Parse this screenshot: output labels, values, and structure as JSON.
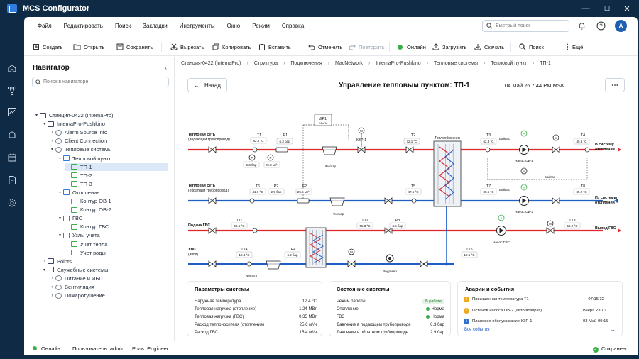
{
  "window": {
    "title": "MCS Configurator",
    "controls": [
      "—",
      "☐",
      "✕"
    ]
  },
  "menu": [
    "Файл",
    "Редактировать",
    "Поиск",
    "Закладки",
    "Инструменты",
    "Окно",
    "Режим",
    "Справка"
  ],
  "quick_search": {
    "placeholder": "Быстрый поиск"
  },
  "user": {
    "avatar": "A"
  },
  "toolbar": {
    "create": "Создать",
    "open": "Открыть",
    "save": "Сохранить",
    "cut": "Вырезать",
    "copy": "Копировать",
    "paste": "Вставить",
    "undo": "Отменить",
    "redo": "Повторить",
    "online": "Онлайн",
    "upload": "Загрузить",
    "download": "Скачать",
    "search": "Поиск",
    "more": "Ещё"
  },
  "navigator": {
    "title": "Навигатор",
    "search_placeholder": "Поиск в навигаторе",
    "tree": [
      {
        "label": "Станция-0422 (IntemaPro)",
        "level": 0,
        "caret": "▾"
      },
      {
        "label": "IntemaPro-Pushkino",
        "level": 1,
        "caret": "▾"
      },
      {
        "label": "Alarm Source Info",
        "level": 2,
        "caret": "›"
      },
      {
        "label": "Client Connection",
        "level": 2,
        "caret": "›"
      },
      {
        "label": "Тепловые системы",
        "level": 2,
        "caret": "▾"
      },
      {
        "label": "Тепловой пункт",
        "level": 3,
        "caret": "▾"
      },
      {
        "label": "ТП-1",
        "level": 4,
        "caret": "",
        "selected": true
      },
      {
        "label": "ТП-2",
        "level": 4,
        "caret": ""
      },
      {
        "label": "ТП-3",
        "level": 4,
        "caret": ""
      },
      {
        "label": "Отопление",
        "level": 3,
        "caret": "▾"
      },
      {
        "label": "Контур ОВ-1",
        "level": 4,
        "caret": ""
      },
      {
        "label": "Контур ОВ-2",
        "level": 4,
        "caret": ""
      },
      {
        "label": "ГВС",
        "level": 3,
        "caret": "▾"
      },
      {
        "label": "Контур ГВС",
        "level": 4,
        "caret": ""
      },
      {
        "label": "Узлы учета",
        "level": 3,
        "caret": "▾"
      },
      {
        "label": "Учет тепла",
        "level": 4,
        "caret": ""
      },
      {
        "label": "Учет воды",
        "level": 4,
        "caret": ""
      },
      {
        "label": "Points",
        "level": 1,
        "caret": "›"
      },
      {
        "label": "Служебные системы",
        "level": 1,
        "caret": "▾"
      },
      {
        "label": "Питание и ИБП",
        "level": 2,
        "caret": "›"
      },
      {
        "label": "Вентиляция",
        "level": 2,
        "caret": "›"
      },
      {
        "label": "Пожаротушение",
        "level": 2,
        "caret": "›"
      }
    ]
  },
  "breadcrumbs": [
    "Станция-0422 (IntemaPro)",
    "Структура",
    "Подключения",
    "MacNetwork",
    "IntemaPro-Pushkino",
    "Тепловые системы",
    "Тепловой пункт",
    "ТП-1"
  ],
  "page": {
    "back": "Назад",
    "title": "Управление тепловым пунктом: ТП-1",
    "datetime": "04 Май 26 7:44 PM MSK",
    "more": "⋯"
  },
  "diagram": {
    "supply_label_1": "Тепловая сеть",
    "supply_label_2": "(подающий трубопровод)",
    "return_label_1": "Тепловая сеть",
    "return_label_2": "(обратный трубопровод)",
    "dhw_supply_label": "Подача ГВС",
    "cold_label_1": "ХВС",
    "cold_label_2": "(ввод)",
    "to_heating_1": "В систему",
    "to_heating_2": "отопления",
    "from_heating_1": "Из системы",
    "from_heating_2": "отопления",
    "dhw_out": "Выход ГВС",
    "heat_exchanger": "Теплообменник",
    "dp": {
      "tag": "ΔP1",
      "value": "24 кПа"
    },
    "tags": {
      "T1": "Т1",
      "F1": "F1",
      "T2": "Т2",
      "T3": "Т3",
      "T4": "Т4",
      "T5": "Т5",
      "T6": "Т6",
      "T7": "Т7",
      "T8": "Т8",
      "P2": "P2",
      "F2": "F2",
      "T11": "Т11",
      "T12": "Т12",
      "P3": "P3",
      "T13": "Т13",
      "T14": "Т14",
      "P4": "P4",
      "T15": "Т15",
      "KZR": "КЗР-1"
    },
    "readings": {
      "T1": "82.4 °C",
      "F1": "6.3 бар",
      "P1": "6.3 бар",
      "Pf1": "25.8 м³/ч",
      "T2": "72.1 °C",
      "T3": "62.3 °C",
      "T4": "45.8 °C",
      "T6": "41.7 °C",
      "P2": "2.9 бар",
      "F2": "25.6 м³/ч",
      "T5": "47.6 °C",
      "T7": "38.6 °C",
      "T8": "35.2 °C",
      "T11": "60.6 °C",
      "T12": "55.8 °C",
      "P3": "3.5 бар",
      "T13": "55.2 °C",
      "T14": "12.4 °C",
      "P4": "6.2 бар",
      "T15": "12.6 °C"
    },
    "filter": "Фильтр",
    "bypass": "Байпас",
    "pump_ov1": "Насос ОВ-1",
    "pump_ov2": "Насос ОВ-2",
    "pump_gvs": "Насос ГВС",
    "water_meter": "Водомер",
    "gauge_letters": {
      "P": "P",
      "M": "M",
      "A": "A"
    }
  },
  "params": {
    "title": "Параметры системы",
    "rows": [
      {
        "k": "Наружная температура",
        "v": "12.4 °C"
      },
      {
        "k": "Тепловая нагрузка (отопление)",
        "v": "1.24 МВт"
      },
      {
        "k": "Тепловая нагрузка (ГВС)",
        "v": "0.35 МВт"
      },
      {
        "k": "Расход теплоносителя (отопление)",
        "v": "25.6 м³/ч"
      },
      {
        "k": "Расход ГВС",
        "v": "15.4 м³/ч"
      }
    ]
  },
  "state": {
    "title": "Состояние системы",
    "rows": [
      {
        "k": "Режим работы",
        "v": "В работе",
        "kind": "badge"
      },
      {
        "k": "Отопление",
        "v": "Норма",
        "kind": "dot"
      },
      {
        "k": "ГВС",
        "v": "Норма",
        "kind": "dot"
      },
      {
        "k": "Давление в подающем трубопроводе",
        "v": "6.3 бар",
        "kind": "text"
      },
      {
        "k": "Давление в обратном трубопроводе",
        "v": "2.9 бар",
        "kind": "text"
      }
    ]
  },
  "events": {
    "title": "Аварии и события",
    "all": "Все события",
    "arrow": "→",
    "items": [
      {
        "text": "Повышенная температура Т1",
        "time": "07:15:32",
        "level": "warn"
      },
      {
        "text": "Останов насоса ОВ-2 (авто возврат)",
        "time": "Вчера 23:10",
        "level": "warn"
      },
      {
        "text": "Плановое обслуживание КЗР-1",
        "time": "03 Май 09:15",
        "level": "info"
      }
    ]
  },
  "status": {
    "online": "Онлайн",
    "user": "Пользователь: admin",
    "role": "Роль: Engineer",
    "saved": "Сохранено"
  },
  "colors": {
    "supply": "#e0262d",
    "return": "#1f5fc4",
    "accent": "#2f7de0",
    "ok": "#3cae4a",
    "warn": "#f0a81b",
    "info": "#2f6fd1",
    "frame": "#0f2a44"
  }
}
